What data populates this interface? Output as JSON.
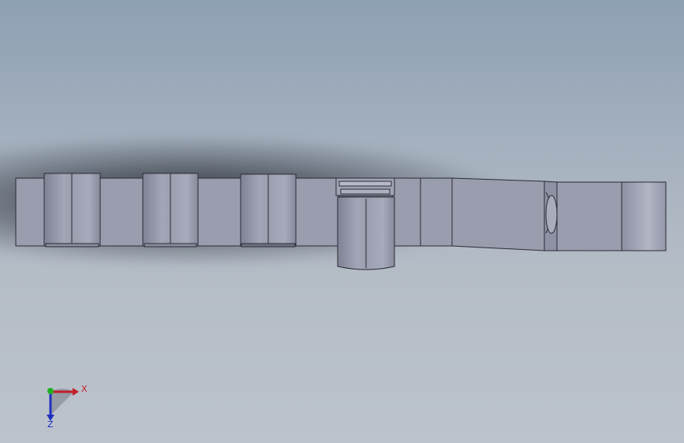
{
  "viewport": {
    "background_top": "#8ea0b3",
    "background_bottom": "#bcc3cb"
  },
  "part": {
    "face_color": "#9a9dae",
    "edge_color": "#2a2c36",
    "cylinder_color": "#9ea1b2"
  },
  "triad": {
    "x_label": "X",
    "z_label": "Z",
    "x_color": "#c0202a",
    "y_color": "#20b020",
    "z_color": "#2030c0"
  }
}
